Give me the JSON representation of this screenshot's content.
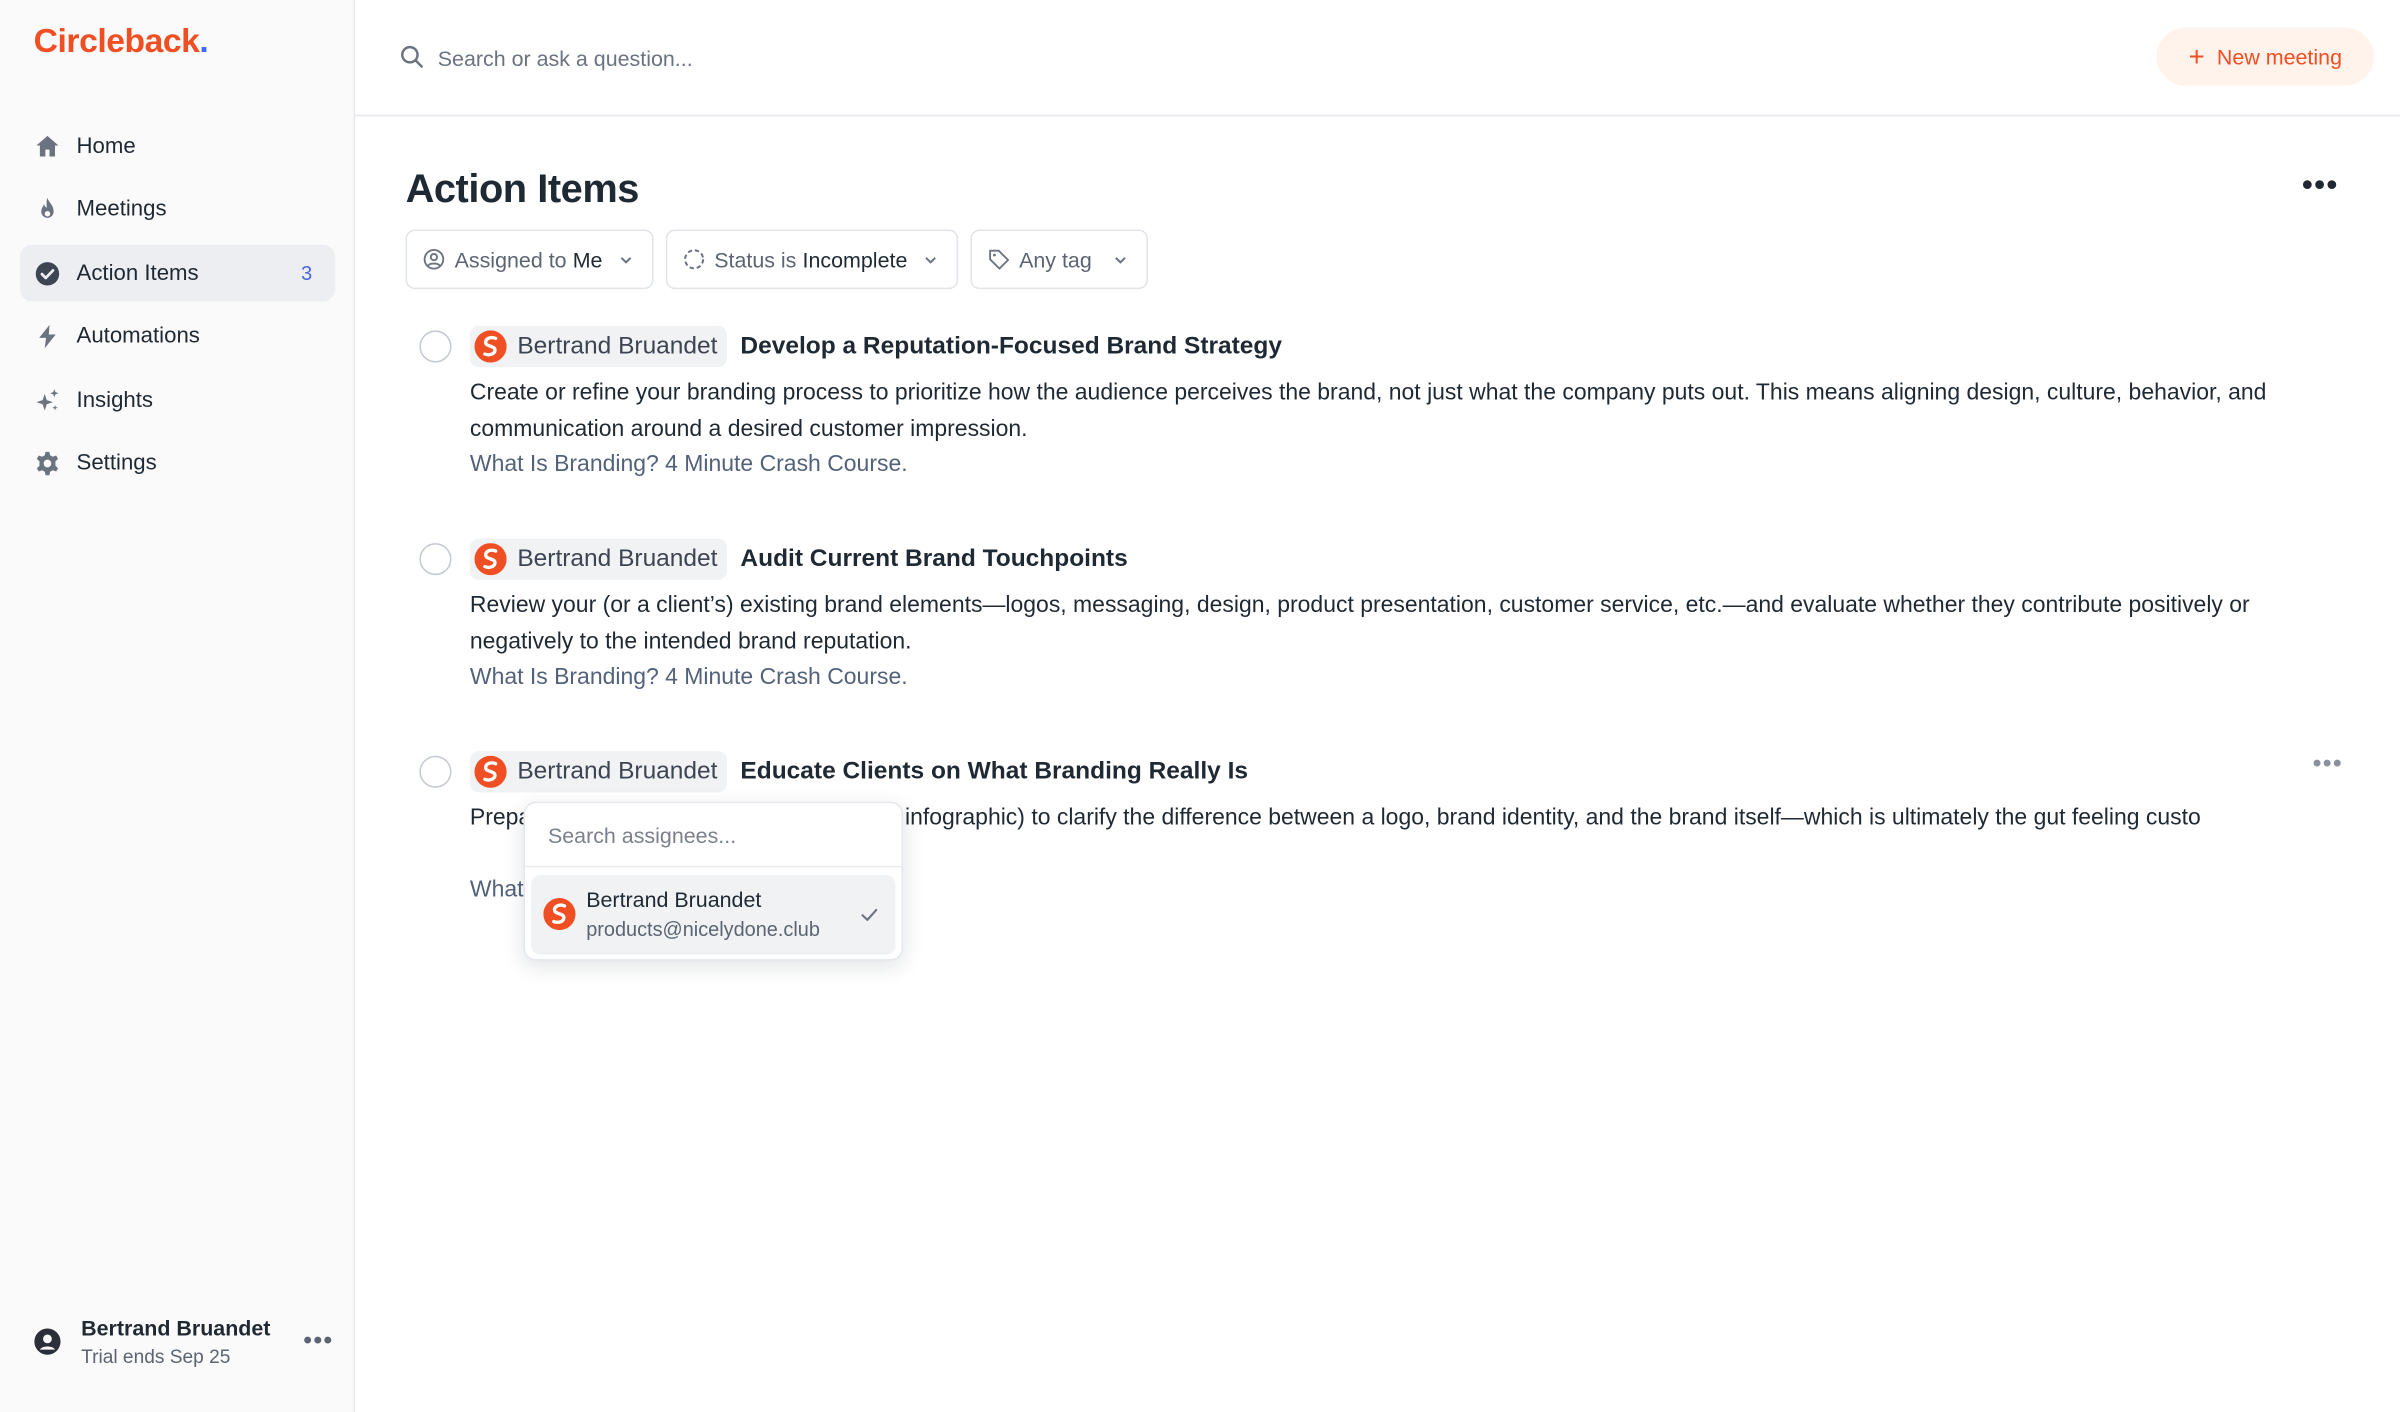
{
  "app": {
    "logo": "Circleback",
    "logo_dot": "."
  },
  "sidebar": {
    "items": [
      {
        "label": "Home",
        "icon": "home-icon"
      },
      {
        "label": "Meetings",
        "icon": "flame-icon"
      },
      {
        "label": "Action Items",
        "icon": "check-circle-icon",
        "badge": "3",
        "active": true
      },
      {
        "label": "Automations",
        "icon": "bolt-icon"
      },
      {
        "label": "Insights",
        "icon": "sparkles-icon"
      },
      {
        "label": "Settings",
        "icon": "gear-icon"
      }
    ],
    "user": {
      "name": "Bertrand Bruandet",
      "trial": "Trial ends Sep 25",
      "more": "•••"
    }
  },
  "topbar": {
    "search_placeholder": "Search or ask a question...",
    "new_meeting": "New meeting"
  },
  "page": {
    "title": "Action Items",
    "more": "•••",
    "filters": {
      "assigned_prefix": "Assigned to",
      "assigned_value": "Me",
      "status_prefix": "Status is",
      "status_value": "Incomplete",
      "tag_label": "Any tag"
    }
  },
  "items": [
    {
      "assignee": "Bertrand Bruandet",
      "title": "Develop a Reputation-Focused Brand Strategy",
      "description": "Create or refine your branding process to prioritize how the audience perceives the brand, not just what the company puts out. This means aligning design, culture, behavior, and communication around a desired customer impression.",
      "link": "What Is Branding? 4 Minute Crash Course."
    },
    {
      "assignee": "Bertrand Bruandet",
      "title": "Audit Current Brand Touchpoints",
      "description": "Review your (or a client’s) existing brand elements—logos, messaging, design, product presentation, customer service, etc.—and evaluate whether they contribute positively or negatively to the intended brand reputation.",
      "link": "What Is Branding? 4 Minute Crash Course."
    },
    {
      "assignee": "Bertrand Bruandet",
      "title": "Educate Clients on What Branding Really Is",
      "description": "Prepa                                              slide or infographic) to clarify the difference between a logo, brand identity, and the brand itself—which is ultimately the gut feeling custo",
      "link": "What",
      "more": "•••"
    }
  ],
  "assignee_dropdown": {
    "search_placeholder": "Search assignees...",
    "option_name": "Bertrand Bruandet",
    "option_email": "products@nicelydone.club"
  },
  "colors": {
    "brand": "#f04e23",
    "accent_dot": "#3b6cf6",
    "badge": "#4a64d8"
  }
}
